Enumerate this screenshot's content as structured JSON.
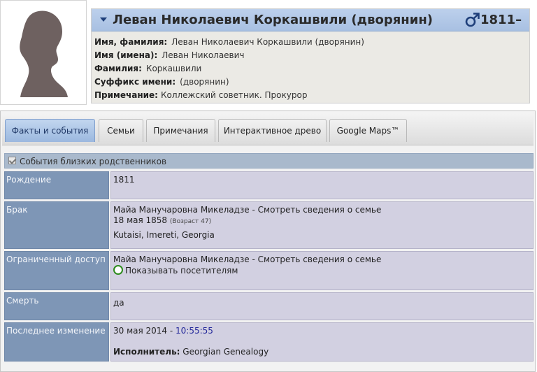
{
  "person": {
    "full_name": "Леван Николаевич Коркашвили (дворянин)",
    "birth_year": "1811–",
    "sex_icon": "male-icon",
    "fields": [
      {
        "label": "Имя, фамилия:",
        "value": "Леван Николаевич Коркашвили (дворянин)"
      },
      {
        "label": "Имя (имена):",
        "value": "Леван Николаевич"
      },
      {
        "label": "Фамилия:",
        "value": "Коркашвили"
      },
      {
        "label": "Суффикс имени:",
        "value": "(дворянин)"
      },
      {
        "label": "Примечание:",
        "value": "Коллежский советник. Прокурор"
      }
    ]
  },
  "tabs": [
    {
      "label": "Факты и события",
      "active": true
    },
    {
      "label": "Семьи",
      "active": false
    },
    {
      "label": "Примечания",
      "active": false
    },
    {
      "label": "Интерактивное древо",
      "active": false
    },
    {
      "label": "Google Maps™",
      "active": false
    }
  ],
  "section": {
    "checkbox_label": "События близких родственников",
    "checked": true
  },
  "facts": {
    "birth": {
      "label": "Рождение",
      "value": "1811"
    },
    "marriage": {
      "label": "Брак",
      "spouse": "Майа Манучаровна Микеладзе - Смотреть сведения о семье",
      "date": "18 мая 1858",
      "age": "(Возраст 47)",
      "place": "Kutaisi, Imereti, Georgia"
    },
    "restricted": {
      "label": "Ограниченный доступ",
      "spouse": "Майа Манучаровна Микеладзе - Смотреть сведения о семье",
      "visibility": "Показывать посетителям"
    },
    "death": {
      "label": "Смерть",
      "value": "да"
    },
    "last_change": {
      "label": "Последнее изменение",
      "date": "30 мая 2014",
      "separator": " - ",
      "time": "10:55:55",
      "author_label": "Исполнитель:",
      "author": "Georgian Genealogy"
    }
  },
  "colors": {
    "name_bar": "#a8c0e2",
    "fact_label_bg": "#7e96b6",
    "fact_value_bg": "#d2d0e1",
    "male_icon": "#1f3f7a"
  }
}
